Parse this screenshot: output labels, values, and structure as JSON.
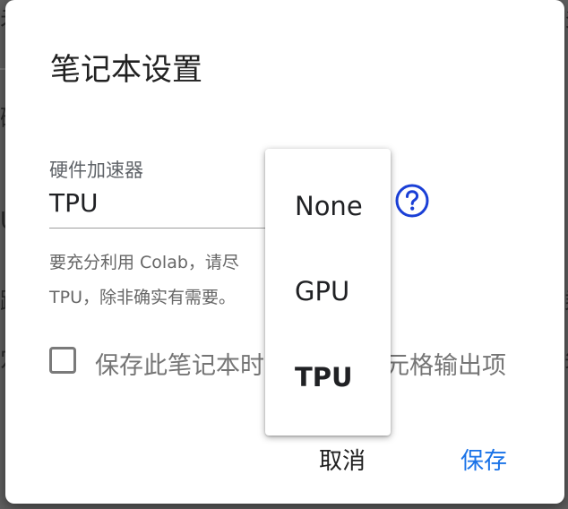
{
  "dialog": {
    "title": "笔记本设置",
    "field_label": "硬件加速器",
    "selected_value": "TPU",
    "description_line1": "要充分利用 Colab，请尽",
    "description_line2": "TPU，除非确实有需要。",
    "checkbox_label": "保存此笔记本时省略代码单元格输出项",
    "checkbox_checked": false,
    "cancel_label": "取消",
    "save_label": "保存",
    "help_icon": "help-circle-icon"
  },
  "dropdown": {
    "options": [
      "None",
      "GPU",
      "TPU"
    ],
    "selected": "TPU"
  },
  "colors": {
    "primary": "#1a73e8",
    "help_icon": "#1a3fd6"
  }
}
